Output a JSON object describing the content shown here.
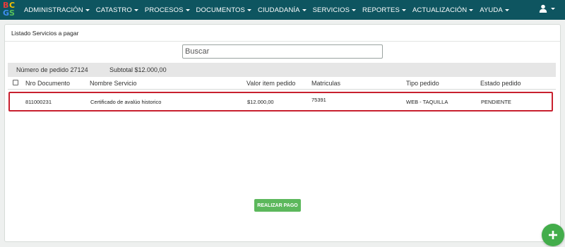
{
  "nav": {
    "logo_letters": [
      "B",
      "C",
      "G",
      "S"
    ],
    "logo_colors": [
      "#e93b3b",
      "#f5c200",
      "#3f8ef1",
      "#56c25b"
    ],
    "items": [
      {
        "label": "ADMINISTRACIÓN"
      },
      {
        "label": "CATASTRO"
      },
      {
        "label": "PROCESOS"
      },
      {
        "label": "DOCUMENTOS"
      },
      {
        "label": "CIUDADANÍA"
      },
      {
        "label": "SERVICIOS"
      },
      {
        "label": "REPORTES"
      },
      {
        "label": "ACTUALIZACIÓN"
      },
      {
        "label": "AYUDA"
      }
    ],
    "user_icon": "user-icon"
  },
  "card": {
    "title": "Listado Servicios a pagar",
    "search_placeholder": "Buscar",
    "order_label": "Número de pedido 27124",
    "subtotal_label": "Subtotal $12.000,00"
  },
  "table": {
    "columns": [
      "Nro Documento",
      "Nombre Servicio",
      "Valor item pedido",
      "Matriculas",
      "Tipo pedido",
      "Estado pedido"
    ],
    "rows": [
      {
        "nro_documento": "811000231",
        "nombre_servicio": "Certificado de avalúo historico",
        "valor_item": "$12.000,00",
        "matriculas": "75391",
        "tipo_pedido": "WEB - TAQUILLA",
        "estado_pedido": "PENDIENTE"
      }
    ]
  },
  "actions": {
    "pay_label": "REALIZAR PAGO",
    "fab_icon": "plus-icon"
  },
  "colors": {
    "navbar": "#0e5560",
    "highlight_border": "#c8202e",
    "button_green": "#5cb85c",
    "fab_green": "#43ad4b"
  }
}
